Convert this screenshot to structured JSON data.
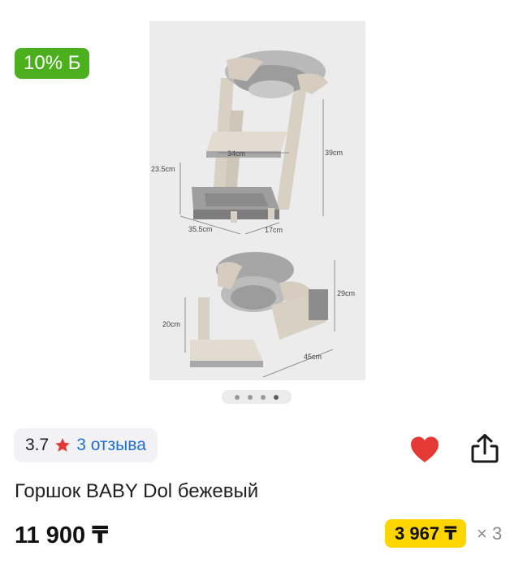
{
  "badge": {
    "discount_label": "10% Б",
    "color": "#4caf1e"
  },
  "gallery": {
    "dimensions_top": [
      "23.5cm",
      "34cm",
      "39cm",
      "35.5cm",
      "17cm"
    ],
    "dimensions_bottom": [
      "29cm",
      "20cm",
      "45cm"
    ],
    "dots": [
      {
        "active": false
      },
      {
        "active": false
      },
      {
        "active": false
      },
      {
        "active": true
      }
    ]
  },
  "rating": {
    "value": "3.7",
    "reviews_label": "3 отзыва",
    "star_color": "#e53935",
    "link_color": "#1e6fd1"
  },
  "actions": {
    "favorite_icon": "heart-icon",
    "favorite_color": "#e53935",
    "share_icon": "share-icon"
  },
  "product": {
    "title": "Горшок BABY Dol бежевый",
    "price": "11 900 ₸",
    "installment_amount": "3 967 ₸",
    "installment_multiplier": "× 3",
    "installment_color": "#ffd500"
  }
}
